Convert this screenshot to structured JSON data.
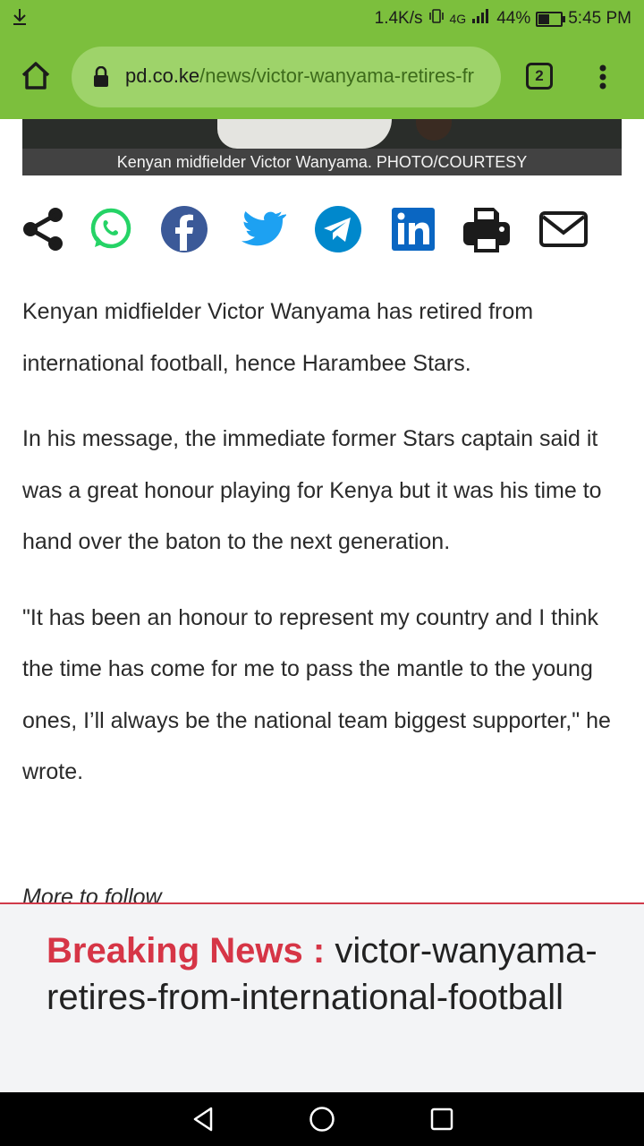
{
  "status_bar": {
    "download_indicator": "download-icon",
    "speed": "1.4K/s",
    "network_type": "4G",
    "battery_percent": "44%",
    "time": "5:45 PM"
  },
  "browser": {
    "url_domain": "pd.co.ke",
    "url_path": "/news/victor-wanyama-retires-fr",
    "tab_count": "2"
  },
  "article": {
    "image_caption": "Kenyan midfielder Victor Wanyama. PHOTO/COURTESY",
    "share_icons": [
      "share-icon",
      "whatsapp-icon",
      "facebook-icon",
      "twitter-icon",
      "telegram-icon",
      "linkedin-icon",
      "print-icon",
      "email-icon"
    ],
    "paragraphs": [
      "Kenyan midfielder Victor Wanyama has retired from international football, hence Harambee Stars.",
      "In his message, the immediate former Stars captain said it was a great honour playing for Kenya but it was his time to hand over the baton to the next generation.",
      "\"It has been an honour to represent my country and I think the time has come for me to pass the mantle to the young ones, I’ll always be the national team biggest supporter,\" he wrote."
    ],
    "more_text": "More to follow"
  },
  "breaking_news": {
    "label": "Breaking News :",
    "headline": "victor-wanyama-retires-from-international-football"
  },
  "colors": {
    "chrome_green": "#7cbf3d",
    "breaking_red": "#d63546",
    "facebook": "#3b5998",
    "twitter": "#1da1f2",
    "telegram": "#0088cc",
    "linkedin": "#0a66c2",
    "whatsapp": "#25d366"
  }
}
